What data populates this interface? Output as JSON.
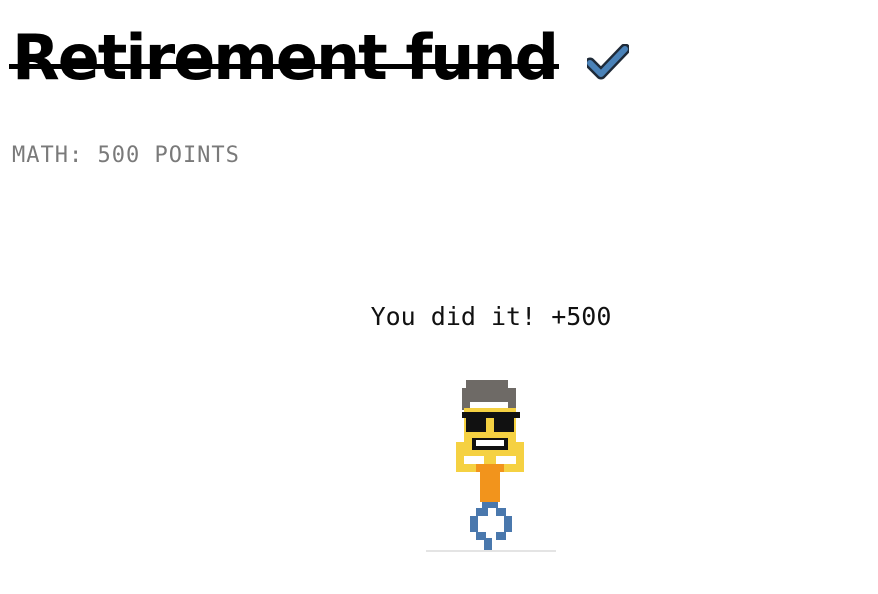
{
  "task": {
    "title": "Retirement fund",
    "completed_icon": "checkmark-icon",
    "category_label": "MATH: 500 POINTS"
  },
  "celebration": {
    "message": "You did it! +500",
    "character": "pixel-character"
  },
  "colors": {
    "check_blue": "#4a82b8",
    "skin": "#f5d142",
    "shirt": "#f2941c",
    "pants": "#4a78ad",
    "hair": "#6e6a66"
  }
}
